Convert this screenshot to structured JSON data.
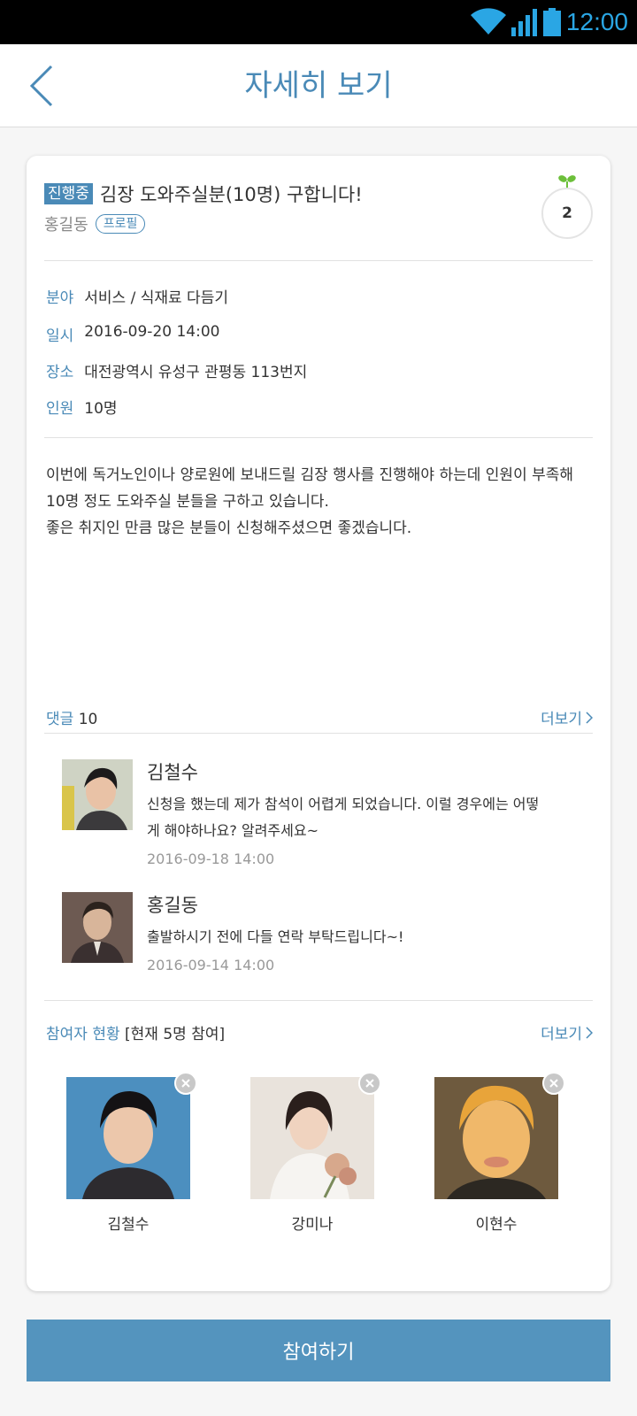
{
  "status_bar": {
    "time": "12:00"
  },
  "header": {
    "title": "자세히 보기"
  },
  "post": {
    "status": "진행중",
    "title": "김장 도와주실분(10명) 구합니다!",
    "author": "홍길동",
    "profile_label": "프로필",
    "count": "2",
    "info": {
      "field_label": "분야",
      "field_value": "서비스 / 식재료 다듬기",
      "date_label": "일시",
      "date_value": "2016-09-20 14:00",
      "place_label": "장소",
      "place_value": "대전광역시 유성구 관평동 113번지",
      "people_label": "인원",
      "people_value": "10명"
    },
    "description": [
      "이번에 독거노인이나 양로원에 보내드릴 김장 행사를 진행해야 하는데 인원이 부족해",
      "10명 정도 도와주실 분들을 구하고 있습니다.",
      "좋은 취지인 만큼 많은 분들이 신청해주셨으면 좋겠습니다."
    ]
  },
  "comments": {
    "label": "댓글",
    "count": "10",
    "more": "더보기",
    "items": [
      {
        "name": "김철수",
        "text_line1": "신청을 했는데 제가 참석이 어렵게 되었습니다. 이럴 경우에는 어떻",
        "text_line2": "게 해야하나요? 알려주세요~",
        "date": "2016-09-18 14:00"
      },
      {
        "name": "홍길동",
        "text_line1": "출발하시기 전에 다들 연락 부탁드립니다~!",
        "text_line2": "",
        "date": "2016-09-14 14:00"
      }
    ]
  },
  "participants": {
    "label": "참여자 현황",
    "summary": "[현재 5명 참여]",
    "more": "더보기",
    "items": [
      {
        "name": "김철수"
      },
      {
        "name": "강미나"
      },
      {
        "name": "이현수"
      }
    ]
  },
  "join_button": {
    "label": "참여하기"
  },
  "colors": {
    "accent": "#4a8ab7",
    "button": "#5494be"
  }
}
